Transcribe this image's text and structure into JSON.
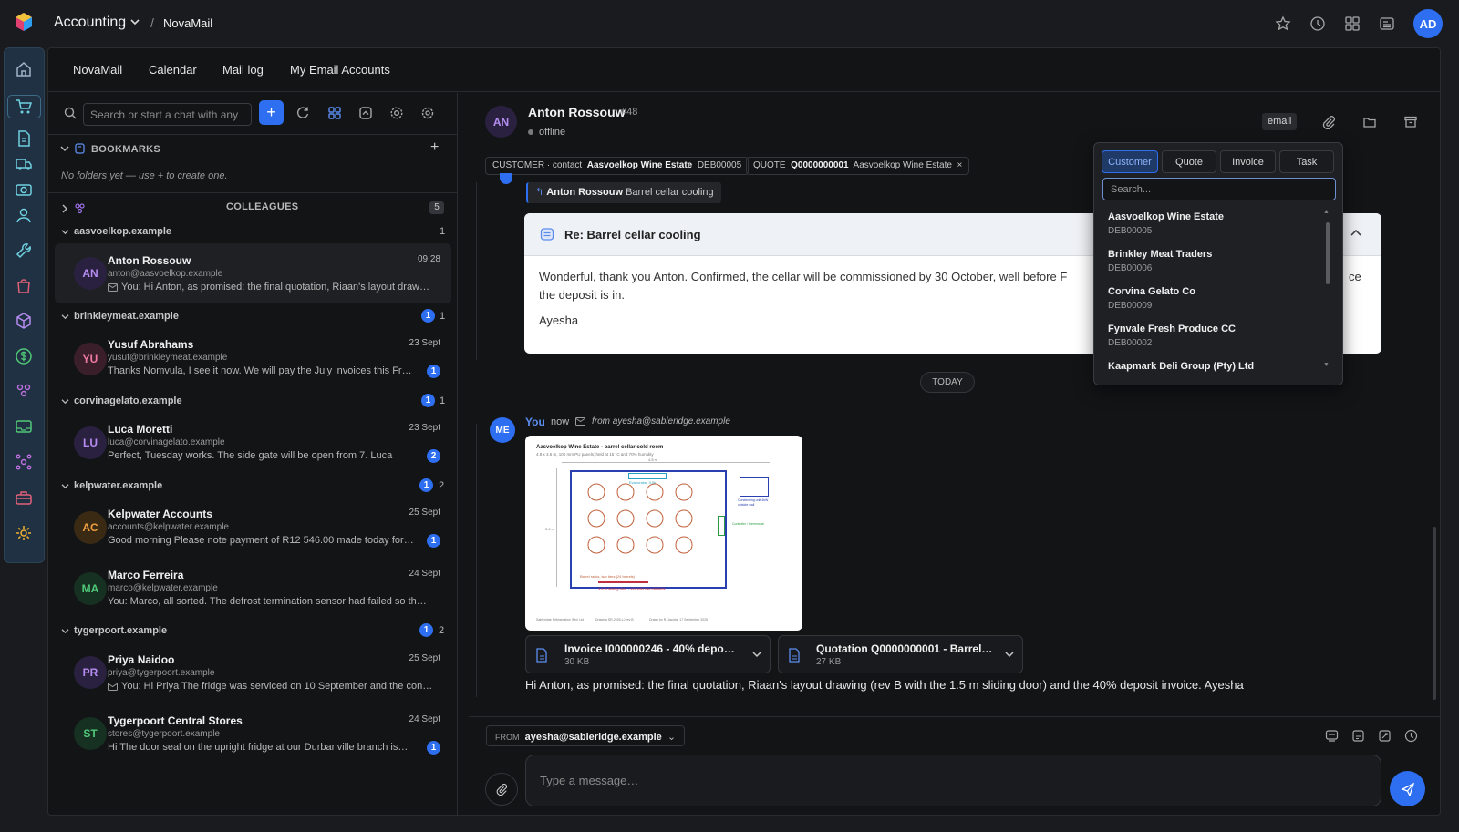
{
  "app": {
    "title": "Accounting",
    "breadcrumb": "NovaMail"
  },
  "user_initials": "AD",
  "nav_tabs": [
    "NovaMail",
    "Calendar",
    "Mail log",
    "My Email Accounts"
  ],
  "search": {
    "placeholder": "Search or start a chat with any"
  },
  "bookmarks": {
    "label": "BOOKMARKS",
    "empty": "No folders yet — use + to create one."
  },
  "colleagues": {
    "label": "COLLEAGUES",
    "count": "5"
  },
  "groups": [
    {
      "domain": "aasvoelkop.example",
      "unread": "",
      "count": "1"
    },
    {
      "domain": "brinkleymeat.example",
      "unread": "1",
      "count": "1"
    },
    {
      "domain": "corvinagelato.example",
      "unread": "1",
      "count": "1"
    },
    {
      "domain": "kelpwater.example",
      "unread": "1",
      "count": "2"
    },
    {
      "domain": "tygerpoort.example",
      "unread": "1",
      "count": "2"
    }
  ],
  "chats": [
    {
      "initials": "AN",
      "name": "Anton Rossouw",
      "email": "anton@aasvoelkop.example",
      "preview": "You: Hi Anton, as promised: the final quotation, Riaan's layout draw…",
      "date": "09:28",
      "unread": "",
      "bg": "#2a2140",
      "fg": "#b58cf0"
    },
    {
      "initials": "YU",
      "name": "Yusuf Abrahams",
      "email": "yusuf@brinkleymeat.example",
      "preview": "Thanks Nomvula, I see it now. We will pay the July invoices this Fr…",
      "date": "23 Sept",
      "unread": "1",
      "bg": "#3a1f2a",
      "fg": "#f07aa0"
    },
    {
      "initials": "LU",
      "name": "Luca Moretti",
      "email": "luca@corvinagelato.example",
      "preview": "Perfect, Tuesday works. The side gate will be open from 7. Luca",
      "date": "23 Sept",
      "unread": "2",
      "bg": "#2a2140",
      "fg": "#b58cf0"
    },
    {
      "initials": "AC",
      "name": "Kelpwater Accounts",
      "email": "accounts@kelpwater.example",
      "preview": "Good morning Please note payment of R12 546.00 made today for…",
      "date": "25 Sept",
      "unread": "1",
      "bg": "#3a2a14",
      "fg": "#f0a040"
    },
    {
      "initials": "MA",
      "name": "Marco Ferreira",
      "email": "marco@kelpwater.example",
      "preview": "You: Marco, all sorted. The defrost termination sensor had failed so th…",
      "date": "24 Sept",
      "unread": "",
      "bg": "#163022",
      "fg": "#50c878"
    },
    {
      "initials": "PR",
      "name": "Priya Naidoo",
      "email": "priya@tygerpoort.example",
      "preview": "You: Hi Priya The fridge was serviced on 10 September and the con…",
      "date": "25 Sept",
      "unread": "",
      "bg": "#2a2140",
      "fg": "#b58cf0"
    },
    {
      "initials": "ST",
      "name": "Tygerpoort Central Stores",
      "email": "stores@tygerpoort.example",
      "preview": "Hi The door seal on the upright fridge at our Durbanville branch is…",
      "date": "24 Sept",
      "unread": "1",
      "bg": "#163022",
      "fg": "#50c878"
    }
  ],
  "contact": {
    "initials": "AN",
    "name": "Anton Rossouw",
    "id": "#48",
    "status": "offline",
    "channel": "email"
  },
  "chips": {
    "customer_label": "CUSTOMER · contact",
    "customer_name": "Aasvoelkop Wine Estate",
    "customer_code": "DEB00005",
    "quote_label": "QUOTE",
    "quote_no": "Q0000000001",
    "quote_name": "Aasvoelkop Wine Estate"
  },
  "reply_ref": {
    "name": "Anton Rossouw",
    "subject": "Barrel cellar cooling"
  },
  "message_card": {
    "subject": "Re: Barrel cellar cooling",
    "body": "Wonderful, thank you Anton. Confirmed, the cellar will be commissioned by 30 October, well before F",
    "body_tail": "ce",
    "body2": "the deposit is in.",
    "signoff": "Ayesha"
  },
  "today_label": "TODAY",
  "outgoing": {
    "avatar": "ME",
    "sender": "You",
    "time": "now",
    "from": "from ayesha@sableridge.example",
    "drawing": {
      "title": "Aasvoelkop Wine Estate - barrel cellar cold room",
      "subtitle": "4.8 x 3.6 m, 100 mm PU panels; held at 15 °C and 70% humidity",
      "evap": "Evaporator, 3.0k",
      "dim_top": "4.8 m",
      "dim_side": "3.6 m",
      "condenser": "Condensing unit 4kW outside wall",
      "controller": "Controller / thermostat",
      "barrels": "Barrel racks, two tiers (24 barrels)",
      "door": "1.5 m sliding door - 100 with two blankets",
      "footer1": "Sableridge Refrigeration (Pty) Ltd",
      "footer2": "Drawing SR-2025-LJ rev B",
      "footer3": "Drawn by R. Jacobs, 17 September 2025"
    },
    "attachments": [
      {
        "name": "Invoice I000000246 - 40% depo…",
        "size": "30 KB"
      },
      {
        "name": "Quotation Q0000000001 - Barrel…",
        "size": "27 KB"
      }
    ],
    "text": "Hi Anton, as promised: the final quotation, Riaan's layout drawing (rev B with the 1.5 m sliding door) and the 40% deposit invoice. Ayesha"
  },
  "composer": {
    "from_label": "FROM",
    "from_value": "ayesha@sableridge.example",
    "placeholder": "Type a message…"
  },
  "dropdown": {
    "tabs": [
      "Customer",
      "Quote",
      "Invoice",
      "Task"
    ],
    "active": "Customer",
    "search_placeholder": "Search...",
    "items": [
      {
        "name": "Aasvoelkop Wine Estate",
        "code": "DEB00005"
      },
      {
        "name": "Brinkley Meat Traders",
        "code": "DEB00006"
      },
      {
        "name": "Corvina Gelato Co",
        "code": "DEB00009"
      },
      {
        "name": "Fynvale Fresh Produce CC",
        "code": "DEB00002"
      },
      {
        "name": "Kaapmark Deli Group (Pty) Ltd",
        "code": ""
      }
    ]
  },
  "colors": {
    "accent": "#2e6ef0",
    "bg": "#131416",
    "rail": "#1f3142"
  }
}
